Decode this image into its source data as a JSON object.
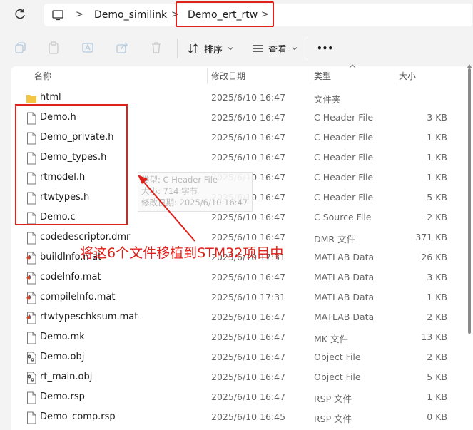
{
  "breadcrumb": {
    "items": [
      "Demo_similink",
      "Demo_ert_rtw"
    ],
    "separator": ">"
  },
  "toolbar": {
    "sort_label": "排序",
    "view_label": "查看",
    "more_label": "•••"
  },
  "columns": {
    "name": "名称",
    "date": "修改日期",
    "type": "类型",
    "size": "大小"
  },
  "files": [
    {
      "name": "html",
      "date": "2025/6/10 16:47",
      "type": "文件夹",
      "size": "",
      "icon": "folder-icon"
    },
    {
      "name": "Demo.h",
      "date": "2025/6/10 16:47",
      "type": "C Header File",
      "size": "3 KB",
      "icon": "file-icon"
    },
    {
      "name": "Demo_private.h",
      "date": "2025/6/10 16:47",
      "type": "C Header File",
      "size": "1 KB",
      "icon": "file-icon"
    },
    {
      "name": "Demo_types.h",
      "date": "2025/6/10 16:47",
      "type": "C Header File",
      "size": "1 KB",
      "icon": "file-icon"
    },
    {
      "name": "rtmodel.h",
      "date": "2025/6/10 16:47",
      "type": "C Header File",
      "size": "1 KB",
      "icon": "file-icon"
    },
    {
      "name": "rtwtypes.h",
      "date": "2025/6/10 16:47",
      "type": "C Header File",
      "size": "5 KB",
      "icon": "file-icon"
    },
    {
      "name": "Demo.c",
      "date": "2025/6/10 16:47",
      "type": "C Source File",
      "size": "2 KB",
      "icon": "file-icon"
    },
    {
      "name": "codedescriptor.dmr",
      "date": "2025/6/10 16:47",
      "type": "DMR 文件",
      "size": "371 KB",
      "icon": "file-icon"
    },
    {
      "name": "buildInfo.mat",
      "date": "2025/6/10 17:31",
      "type": "MATLAB Data",
      "size": "26 KB",
      "icon": "matlab-file-icon"
    },
    {
      "name": "codeInfo.mat",
      "date": "2025/6/10 16:47",
      "type": "MATLAB Data",
      "size": "3 KB",
      "icon": "matlab-file-icon"
    },
    {
      "name": "compileInfo.mat",
      "date": "2025/6/10 17:31",
      "type": "MATLAB Data",
      "size": "1 KB",
      "icon": "matlab-file-icon"
    },
    {
      "name": "rtwtypeschksum.mat",
      "date": "2025/6/10 16:47",
      "type": "MATLAB Data",
      "size": "2 KB",
      "icon": "matlab-file-icon"
    },
    {
      "name": "Demo.mk",
      "date": "2025/6/10 16:47",
      "type": "MK 文件",
      "size": "13 KB",
      "icon": "file-icon"
    },
    {
      "name": "Demo.obj",
      "date": "2025/6/10 16:47",
      "type": "Object File",
      "size": "2 KB",
      "icon": "object-file-icon"
    },
    {
      "name": "rt_main.obj",
      "date": "2025/6/10 16:47",
      "type": "Object File",
      "size": "5 KB",
      "icon": "object-file-icon"
    },
    {
      "name": "Demo.rsp",
      "date": "2025/6/10 16:47",
      "type": "RSP 文件",
      "size": "1 KB",
      "icon": "file-icon"
    },
    {
      "name": "Demo_comp.rsp",
      "date": "2025/6/10 16:45",
      "type": "RSP 文件",
      "size": "0 KB",
      "icon": "file-icon"
    }
  ],
  "tooltip": {
    "line1": "类型: C Header File",
    "line2": "大小: 714 字节",
    "line3": "修改日期: 2025/6/10 16:47"
  },
  "annotation": "将这6个文件移植到STM32项目中",
  "colors": {
    "annotation_red": "#e0201a",
    "folder_yellow": "#f4c542",
    "background": "#f3f3f3"
  }
}
